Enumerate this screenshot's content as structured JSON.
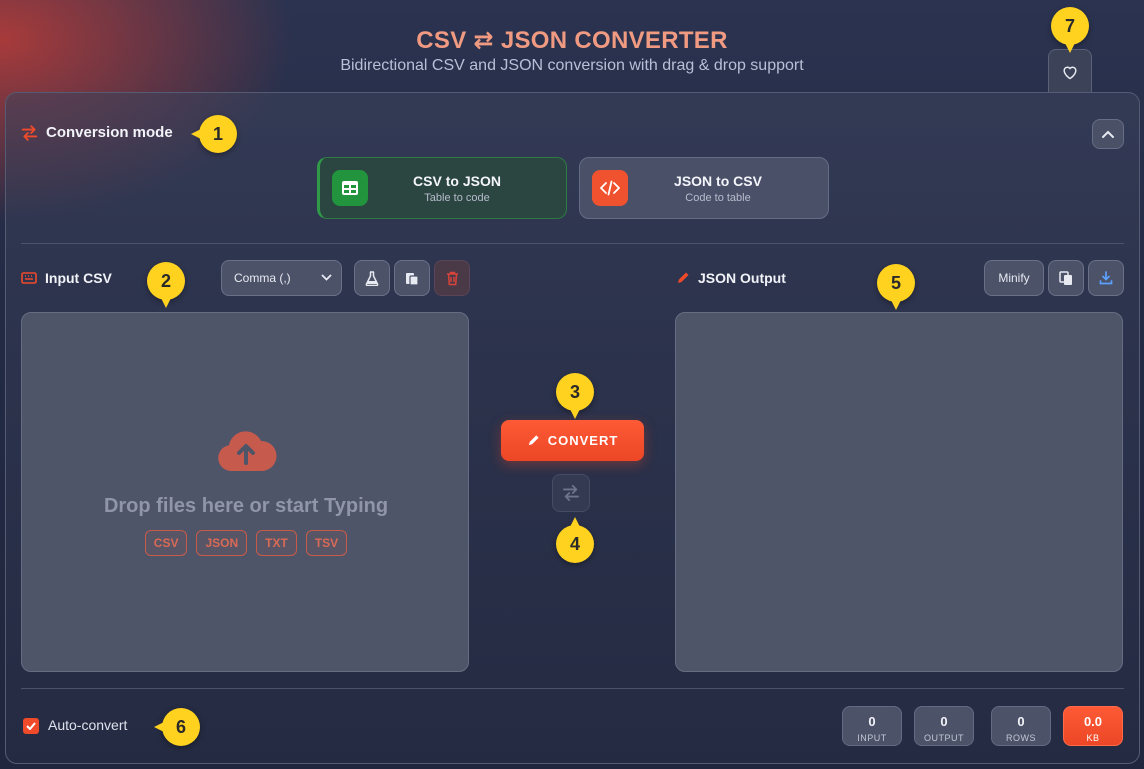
{
  "header": {
    "title": "CSV ⇄ JSON CONVERTER",
    "subtitle": "Bidirectional CSV and JSON conversion with drag & drop support",
    "favorite_icon": "heart-icon"
  },
  "mode": {
    "section_title": "Conversion mode",
    "section_icon": "swap-arrows-icon",
    "cards": [
      {
        "name": "CSV to JSON",
        "desc": "Table to code",
        "icon": "table-icon",
        "active": true
      },
      {
        "name": "JSON to CSV",
        "desc": "Code to table",
        "icon": "code-icon",
        "active": false
      }
    ]
  },
  "input": {
    "label": "Input CSV",
    "delimiter": "Comma (,)",
    "drop_text": "Drop files here or start Typing",
    "formats": [
      "CSV",
      "JSON",
      "TXT",
      "TSV"
    ]
  },
  "output": {
    "label": "JSON Output",
    "minify_label": "Minify"
  },
  "actions": {
    "convert_label": "CONVERT"
  },
  "footer": {
    "auto_convert_label": "Auto-convert",
    "auto_convert_checked": true,
    "stats": [
      {
        "value": "0",
        "label": "INPUT"
      },
      {
        "value": "0",
        "label": "OUTPUT"
      },
      {
        "value": "0",
        "label": "ROWS"
      },
      {
        "value": "0.0",
        "label": "KB"
      }
    ]
  },
  "annotations": [
    "1",
    "2",
    "3",
    "4",
    "5",
    "6",
    "7"
  ],
  "colors": {
    "accent": "#ef4a2a",
    "active_mode": "#2f9a48",
    "badge": "#ffd21f"
  }
}
